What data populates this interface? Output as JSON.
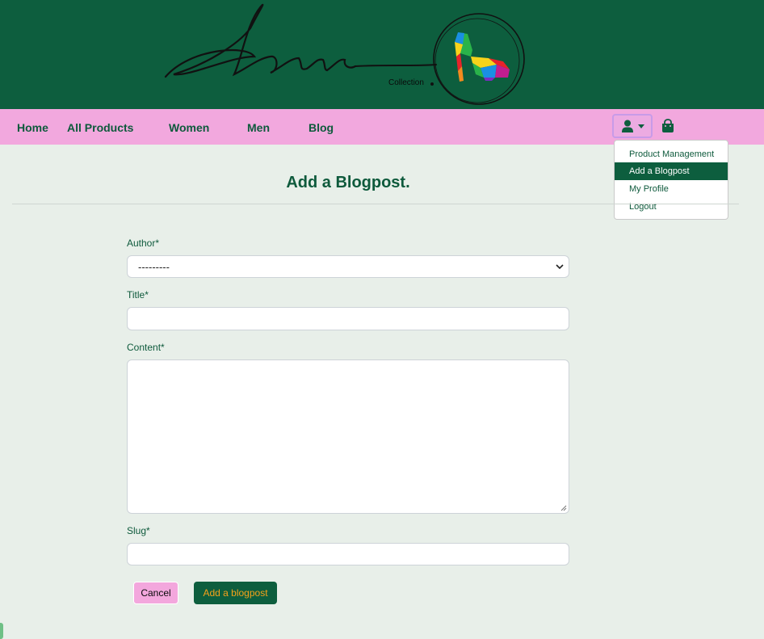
{
  "header": {
    "logo_collection": "Collection"
  },
  "nav": {
    "links": [
      "Home",
      "All Products",
      "Women",
      "Men",
      "Blog"
    ]
  },
  "icons": {
    "user": "user-icon",
    "caret": "caret-down-icon",
    "bag": "shopping-bag-icon"
  },
  "dropdown": {
    "items": [
      "Product Management",
      "Add a Blogpost",
      "My Profile",
      "Logout"
    ],
    "active_index": 1
  },
  "page": {
    "title": "Add a Blogpost."
  },
  "form": {
    "author_label": "Author*",
    "author_value": "---------",
    "title_label": "Title*",
    "title_value": "",
    "content_label": "Content*",
    "content_value": "",
    "slug_label": "Slug*",
    "slug_value": ""
  },
  "buttons": {
    "cancel": "Cancel",
    "submit": "Add a blogpost"
  },
  "colors": {
    "header_bg": "#0d5e3e",
    "nav_bg": "#f2a8de",
    "accent_text": "#f5a21a",
    "page_bg": "#e8efe9"
  }
}
